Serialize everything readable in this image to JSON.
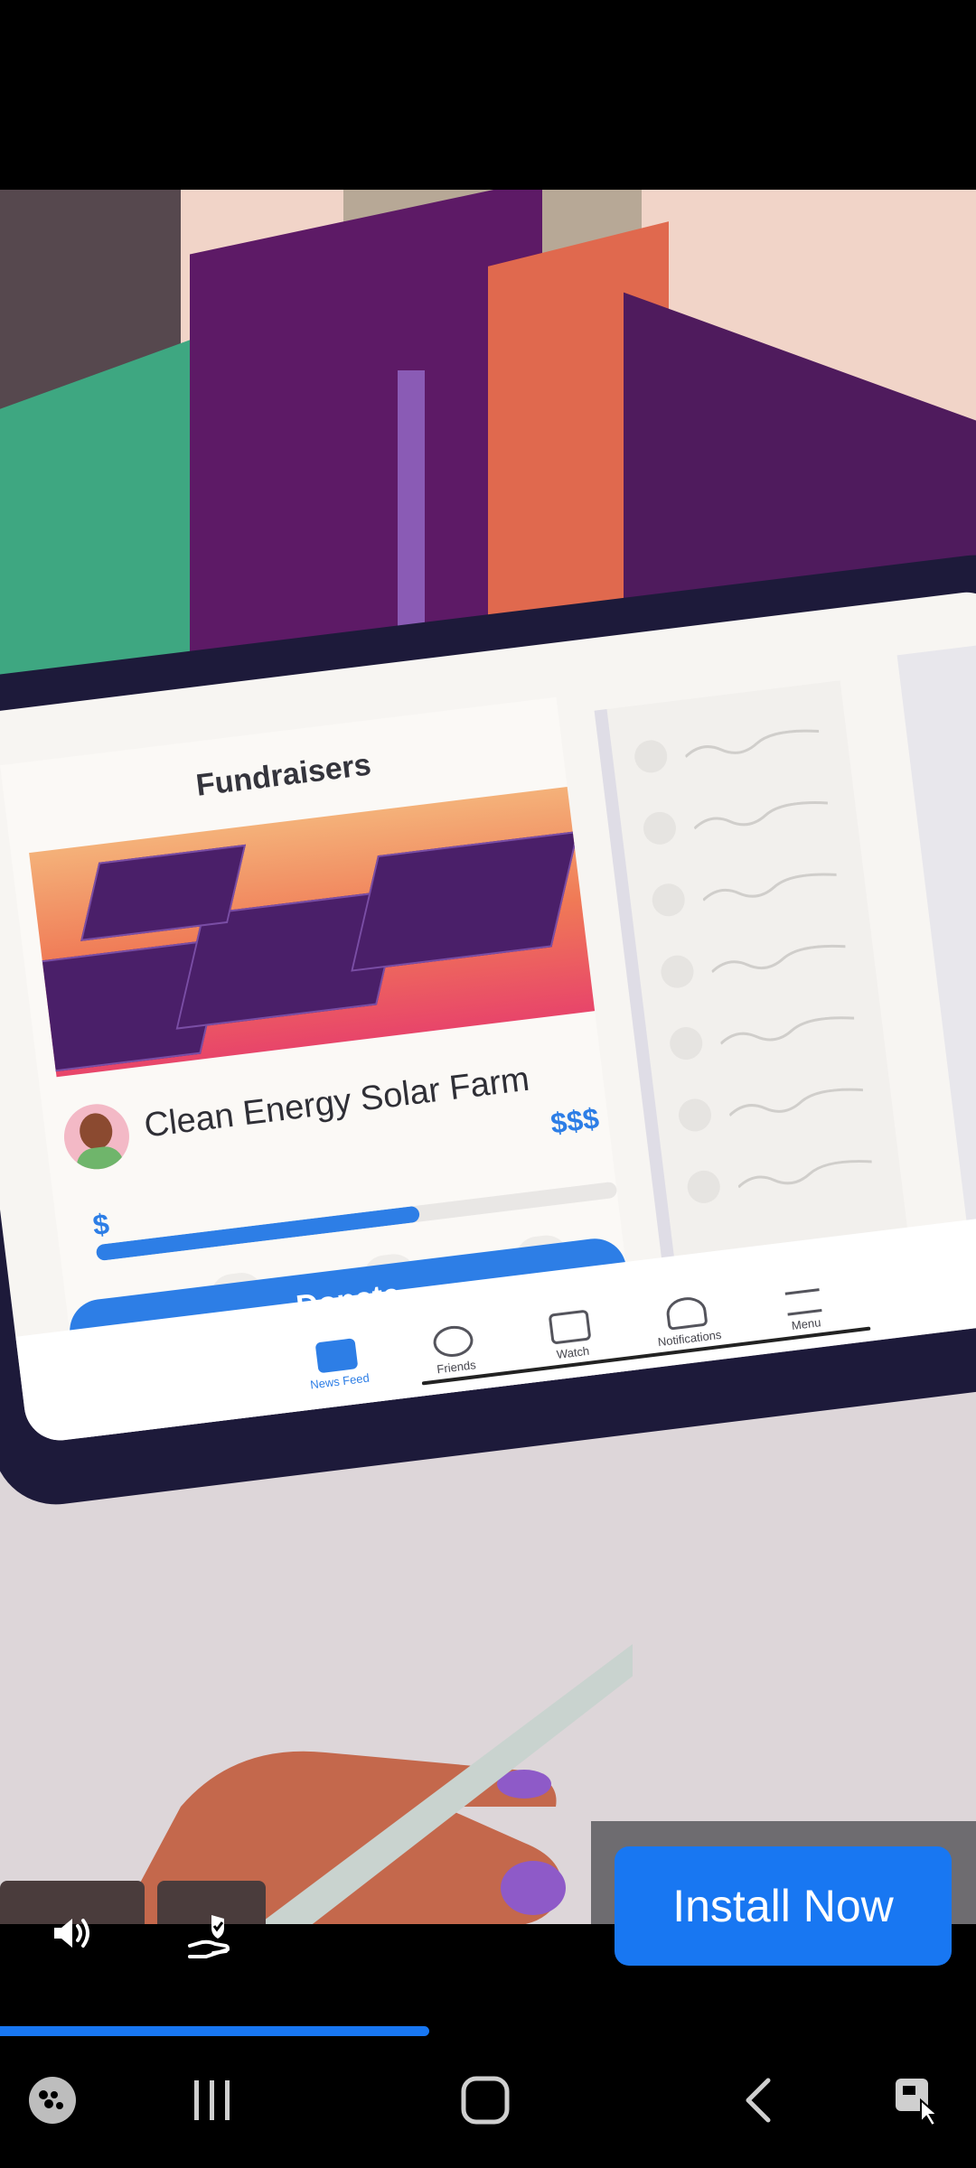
{
  "ad_scene": {
    "screen_title": "Fundraisers",
    "campaign_title": "Clean Energy Solar Farm",
    "amount_big": "$$$",
    "amount_small": "$",
    "progress_fraction": 0.62,
    "donate_label": "Donate",
    "nav": [
      {
        "label": "News Feed"
      },
      {
        "label": "Friends"
      },
      {
        "label": "Watch"
      },
      {
        "label": "Notifications"
      },
      {
        "label": "Menu"
      }
    ]
  },
  "ad_controls": {
    "install_label": "Install Now",
    "video_progress_fraction": 0.44
  },
  "icons": {
    "sound": "speaker-icon",
    "ad_choice": "ad-choices-icon",
    "game": "game-icon",
    "recents": "recents-icon",
    "home": "home-icon",
    "back": "back-icon",
    "assist": "screen-assist-icon"
  },
  "colors": {
    "accent": "#1877f2",
    "tablet_frame": "#1d1a3a",
    "donate_blue": "#2d7ee6"
  }
}
